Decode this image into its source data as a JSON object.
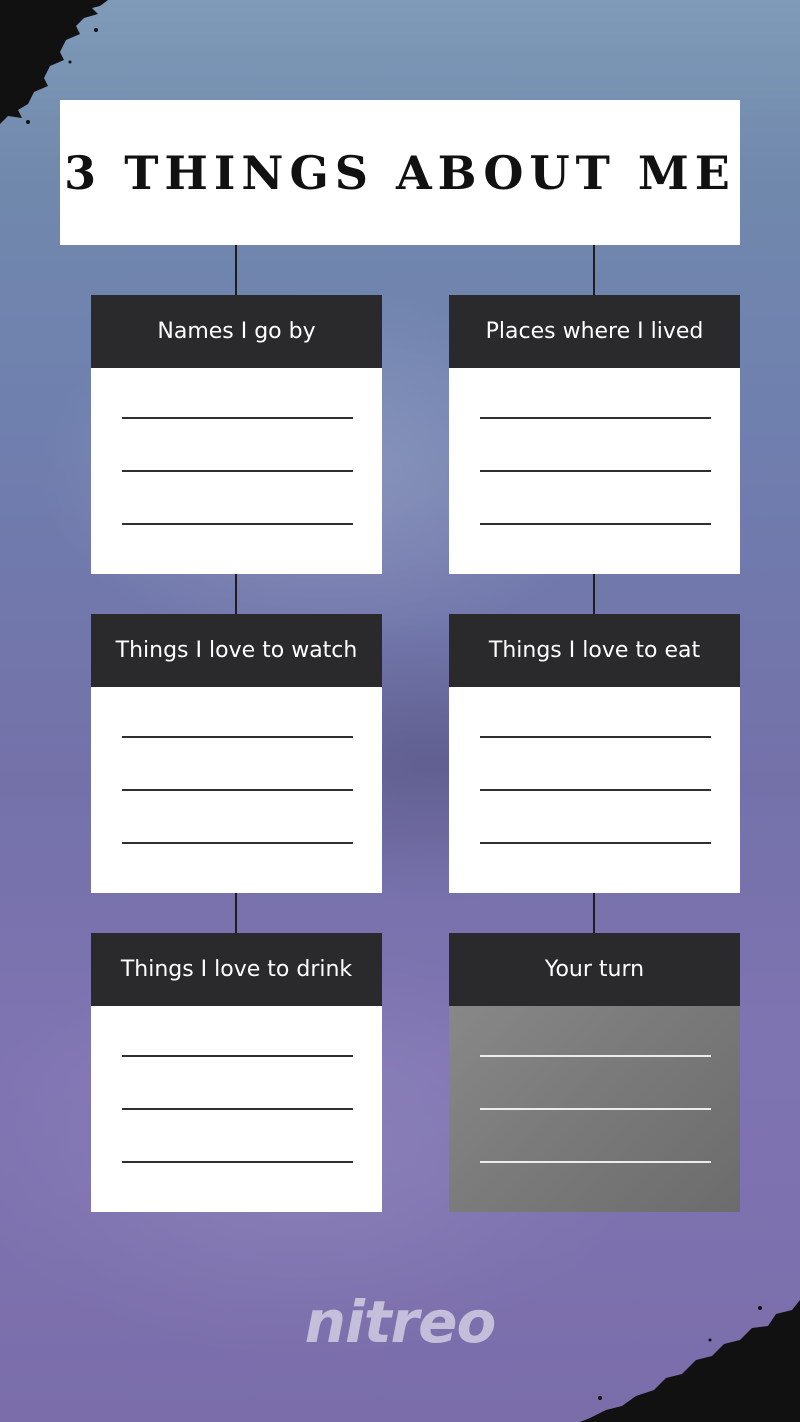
{
  "title": "3 THINGS ABOUT ME",
  "cards": [
    {
      "label": "Names I go by"
    },
    {
      "label": "Places where I lived"
    },
    {
      "label": "Things I love to watch"
    },
    {
      "label": "Things I love to eat"
    },
    {
      "label": "Things I love to drink"
    },
    {
      "label": "Your turn"
    }
  ],
  "brand": "nitreo",
  "colors": {
    "header_bar": "#2a2a2c",
    "card": "#ffffff",
    "highlight_card": "#7b7b7b",
    "background": "#7471a9"
  }
}
